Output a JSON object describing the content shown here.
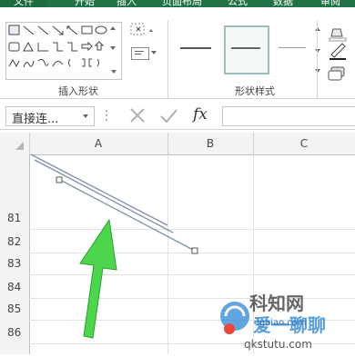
{
  "ribbon": {
    "tabs": [
      "文件",
      "开始",
      "插入",
      "页面布局",
      "公式",
      "数据",
      "审阅"
    ],
    "groups": {
      "insert_shapes_label": "插入形状",
      "shape_styles_label": "形状样式"
    }
  },
  "formula_bar": {
    "name_box_value": "直接连...",
    "fx_label": "fx",
    "formula_value": ""
  },
  "sheet": {
    "columns": [
      "A",
      "B",
      "C"
    ],
    "rows": [
      "81",
      "82",
      "83",
      "84",
      "85",
      "86"
    ]
  },
  "watermark": {
    "brand": "科知网",
    "slogan": "爱一聊聊",
    "domain_top": "igaiao.com",
    "domain_bottom": "qkstutu.com"
  },
  "colors": {
    "accent": "#217346",
    "arrow": "#4cd64c",
    "line": "#7f8fa6"
  }
}
